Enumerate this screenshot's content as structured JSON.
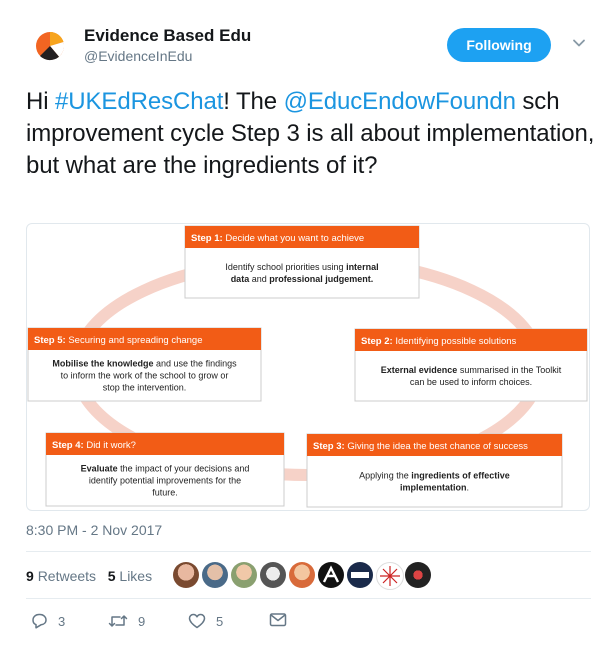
{
  "account": {
    "name": "Evidence Based Edu",
    "handle": "@EvidenceInEdu",
    "follow_label": "Following"
  },
  "tweet": {
    "text_parts": [
      {
        "text": "Hi ",
        "link": false
      },
      {
        "text": "#UKEdResChat",
        "link": true
      },
      {
        "text": "! The ",
        "link": false
      },
      {
        "text": "@EducEndowFoundn",
        "link": true
      },
      {
        "text": " sch improvement cycle Step 3 is all about implementation, but what are the ingredients of it?",
        "link": false
      }
    ],
    "timestamp": "8:30 PM - 2 Nov 2017"
  },
  "diagram": {
    "steps": [
      {
        "id": "step1",
        "title_bold": "Step 1:",
        "title_rest": " Decide what you want to achieve",
        "body": [
          {
            "t": "Identify school priorities using ",
            "b": false
          },
          {
            "t": "internal data",
            "b": true
          },
          {
            "t": " and ",
            "b": false
          },
          {
            "t": "professional judgement.",
            "b": true
          }
        ]
      },
      {
        "id": "step2",
        "title_bold": "Step 2:",
        "title_rest": " Identifying possible solutions",
        "body": [
          {
            "t": "External evidence",
            "b": true
          },
          {
            "t": " summarised in the Toolkit can be used to inform choices.",
            "b": false
          }
        ]
      },
      {
        "id": "step3",
        "title_bold": "Step 3:",
        "title_rest": " Giving the idea the best chance of success",
        "body": [
          {
            "t": "Applying the ",
            "b": false
          },
          {
            "t": "ingredients of effective implementation",
            "b": true
          },
          {
            "t": ".",
            "b": false
          }
        ]
      },
      {
        "id": "step4",
        "title_bold": "Step 4:",
        "title_rest": " Did it work?",
        "body": [
          {
            "t": "Evaluate",
            "b": true
          },
          {
            "t": " the impact of your decisions and identify potential improvements for the future.",
            "b": false
          }
        ]
      },
      {
        "id": "step5",
        "title_bold": "Step 5:",
        "title_rest": " Securing and spreading change",
        "body": [
          {
            "t": "Mobilise the knowledge",
            "b": true
          },
          {
            "t": " and use the findings to inform the work of the school to grow or stop the intervention.",
            "b": false
          }
        ]
      }
    ],
    "colors": {
      "header": "#f25c16",
      "ring": "#f6d2c8",
      "box_border": "#cccccc"
    }
  },
  "stats": {
    "retweets_count": "9",
    "retweets_label": "Retweets",
    "likes_count": "5",
    "likes_label": "Likes"
  },
  "actions": {
    "reply_count": "3",
    "retweet_count": "9",
    "like_count": "5"
  },
  "colors": {
    "accent": "#1da1f2",
    "link": "#1b95e0",
    "muted": "#657786"
  }
}
